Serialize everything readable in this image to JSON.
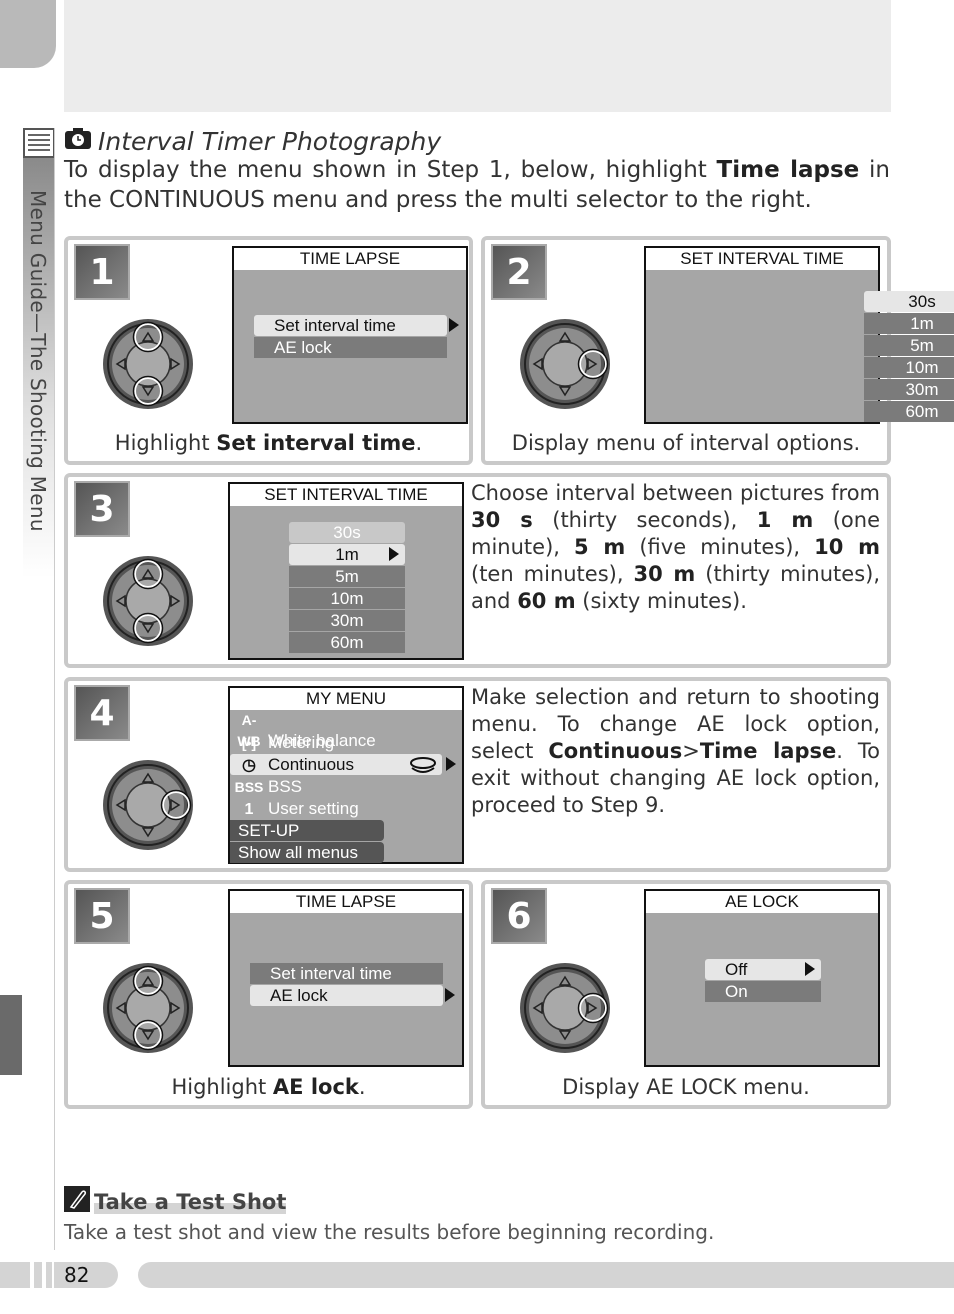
{
  "sidebar": {
    "section_label": "Menu Guide—The Shooting Menu",
    "icon": "menu-list-icon"
  },
  "header": {
    "title": "Interval Timer Photography",
    "title_icon": "interval-timer-camera-icon",
    "intro": [
      {
        "t": "To display the menu shown in Step 1, below, highlight "
      },
      {
        "t": "Time lapse",
        "b": true
      },
      {
        "t": " in the CONTINUOUS menu and press the multi selector to the right."
      }
    ]
  },
  "steps": [
    {
      "num": "1",
      "dial": "updown",
      "screen": {
        "title": "TIME LAPSE",
        "rows": [
          {
            "label": "Set interval time",
            "state": "hl",
            "arrow": "outside"
          },
          {
            "label": "AE lock",
            "state": "dk"
          }
        ]
      },
      "caption": [
        {
          "t": "Highlight "
        },
        {
          "t": "Set interval time",
          "b": true
        },
        {
          "t": "."
        }
      ]
    },
    {
      "num": "2",
      "dial": "right",
      "screen": {
        "title": "SET INTERVAL TIME",
        "rows": [
          {
            "label": "30s",
            "state": "hl",
            "arrow": "inside"
          },
          {
            "label": "1m",
            "state": "dk"
          },
          {
            "label": "5m",
            "state": "dk"
          },
          {
            "label": "10m",
            "state": "dk"
          },
          {
            "label": "30m",
            "state": "dk"
          },
          {
            "label": "60m",
            "state": "dk"
          }
        ]
      },
      "caption": [
        {
          "t": "Display menu of interval options."
        }
      ]
    },
    {
      "num": "3",
      "dial": "updown",
      "screen": {
        "title": "SET INTERVAL TIME",
        "rows": [
          {
            "label": "30s",
            "state": "fd"
          },
          {
            "label": "1m",
            "state": "hl",
            "arrow": "inside"
          },
          {
            "label": "5m",
            "state": "dk"
          },
          {
            "label": "10m",
            "state": "dk"
          },
          {
            "label": "30m",
            "state": "dk"
          },
          {
            "label": "60m",
            "state": "dk"
          }
        ]
      },
      "description": [
        {
          "t": "Choose interval between pictures from "
        },
        {
          "t": "30 s",
          "b": true
        },
        {
          "t": " (thirty seconds), "
        },
        {
          "t": "1 m",
          "b": true
        },
        {
          "t": " (one minute), "
        },
        {
          "t": "5 m",
          "b": true
        },
        {
          "t": " (five minutes), "
        },
        {
          "t": "10 m",
          "b": true
        },
        {
          "t": " (ten minutes), "
        },
        {
          "t": "30 m",
          "b": true
        },
        {
          "t": " (thirty minutes), and "
        },
        {
          "t": "60 m",
          "b": true
        },
        {
          "t": " (sixty minutes)."
        }
      ]
    },
    {
      "num": "4",
      "dial": "right",
      "screen": {
        "title": "MY MENU",
        "rows": [
          {
            "label": "White balance",
            "icon": "A-WB",
            "icon_name": "white-balance-icon",
            "state": "dk0"
          },
          {
            "label": "Metering",
            "icon": "[•]",
            "icon_name": "metering-icon",
            "state": "dk0"
          },
          {
            "label": "Continuous",
            "icon": "◷",
            "icon_name": "continuous-timer-icon",
            "state": "hl",
            "arrow": "outside",
            "extra_icon": "time-lapse-icon"
          },
          {
            "label": "BSS",
            "icon": "BSS",
            "icon_name": "bss-icon",
            "state": "dk0"
          },
          {
            "label": "User setting",
            "icon": "1",
            "icon_name": "user-setting-icon",
            "state": "dk0"
          },
          {
            "label": "SET-UP",
            "state": "sx"
          },
          {
            "label": "Show all menus",
            "state": "sx"
          }
        ]
      },
      "description": [
        {
          "t": "Make selection and return to shooting menu.  To change AE lock option, select "
        },
        {
          "t": "Continuous",
          "b": true
        },
        {
          "t": ">"
        },
        {
          "t": "Time lapse",
          "b": true
        },
        {
          "t": ".  To exit with­out changing AE lock option, proceed to Step 9."
        }
      ]
    },
    {
      "num": "5",
      "dial": "updown",
      "screen": {
        "title": "TIME LAPSE",
        "rows": [
          {
            "label": "Set interval time",
            "state": "dk"
          },
          {
            "label": "AE lock",
            "state": "hl",
            "arrow": "outside"
          }
        ]
      },
      "caption": [
        {
          "t": "Highlight "
        },
        {
          "t": "AE lock",
          "b": true
        },
        {
          "t": "."
        }
      ]
    },
    {
      "num": "6",
      "dial": "right",
      "screen": {
        "title": "AE LOCK",
        "rows": [
          {
            "label": "Off",
            "state": "hl",
            "arrow": "inside"
          },
          {
            "label": "On",
            "state": "dk"
          }
        ]
      },
      "caption": [
        {
          "t": "Display AE LOCK menu."
        }
      ]
    }
  ],
  "note": {
    "icon": "pencil-note-icon",
    "title": "Take a Test Shot",
    "body": "Take a test shot and view the results before beginning recording."
  },
  "footer": {
    "page_number": "82"
  }
}
